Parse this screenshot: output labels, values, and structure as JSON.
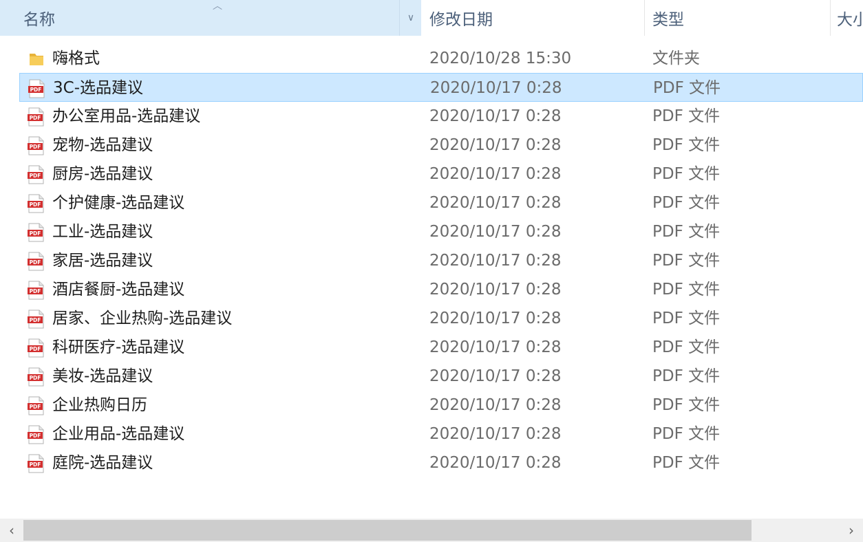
{
  "header": {
    "name_label": "名称",
    "date_label": "修改日期",
    "type_label": "类型",
    "size_label": "大小"
  },
  "files": [
    {
      "name": "嗨格式",
      "date": "2020/10/28 15:30",
      "type": "文件夹",
      "icon": "folder-icon"
    },
    {
      "name": "3C-选品建议",
      "date": "2020/10/17 0:28",
      "type": "PDF 文件",
      "icon": "pdf-icon",
      "selected": true
    },
    {
      "name": "办公室用品-选品建议",
      "date": "2020/10/17 0:28",
      "type": "PDF 文件",
      "icon": "pdf-icon"
    },
    {
      "name": "宠物-选品建议",
      "date": "2020/10/17 0:28",
      "type": "PDF 文件",
      "icon": "pdf-icon"
    },
    {
      "name": "厨房-选品建议",
      "date": "2020/10/17 0:28",
      "type": "PDF 文件",
      "icon": "pdf-icon"
    },
    {
      "name": "个护健康-选品建议",
      "date": "2020/10/17 0:28",
      "type": "PDF 文件",
      "icon": "pdf-icon"
    },
    {
      "name": "工业-选品建议",
      "date": "2020/10/17 0:28",
      "type": "PDF 文件",
      "icon": "pdf-icon"
    },
    {
      "name": "家居-选品建议",
      "date": "2020/10/17 0:28",
      "type": "PDF 文件",
      "icon": "pdf-icon"
    },
    {
      "name": "酒店餐厨-选品建议",
      "date": "2020/10/17 0:28",
      "type": "PDF 文件",
      "icon": "pdf-icon"
    },
    {
      "name": "居家、企业热购-选品建议",
      "date": "2020/10/17 0:28",
      "type": "PDF 文件",
      "icon": "pdf-icon"
    },
    {
      "name": "科研医疗-选品建议",
      "date": "2020/10/17 0:28",
      "type": "PDF 文件",
      "icon": "pdf-icon"
    },
    {
      "name": "美妆-选品建议",
      "date": "2020/10/17 0:28",
      "type": "PDF 文件",
      "icon": "pdf-icon"
    },
    {
      "name": "企业热购日历",
      "date": "2020/10/17 0:28",
      "type": "PDF 文件",
      "icon": "pdf-icon"
    },
    {
      "name": "企业用品-选品建议",
      "date": "2020/10/17 0:28",
      "type": "PDF 文件",
      "icon": "pdf-icon"
    },
    {
      "name": "庭院-选品建议",
      "date": "2020/10/17 0:28",
      "type": "PDF 文件",
      "icon": "pdf-icon"
    }
  ],
  "pdf_badge": "PDF",
  "colors": {
    "header_active_bg": "#d9ebf9",
    "selection_bg": "#cde8ff",
    "selection_border": "#99d1ff",
    "pdf_red": "#d32f2f",
    "folder_yellow": "#f5c84c"
  }
}
